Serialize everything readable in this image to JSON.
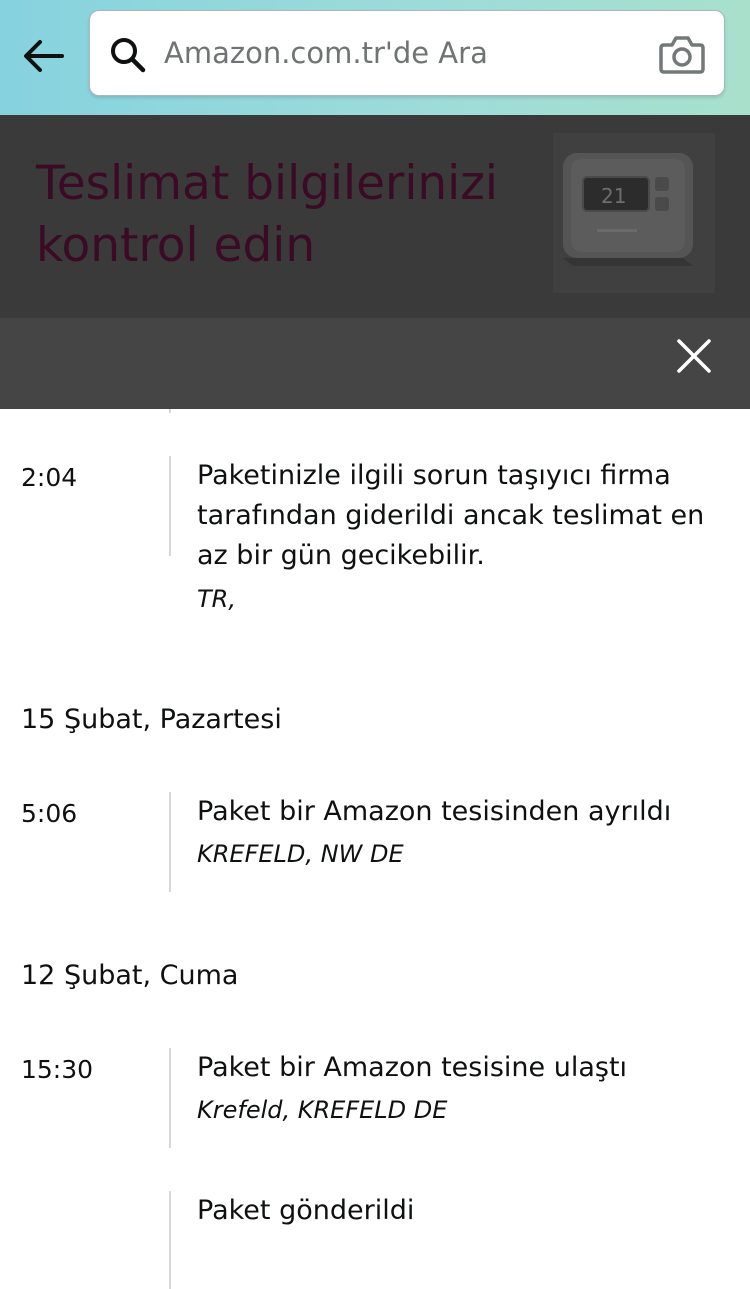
{
  "search": {
    "placeholder": "Amazon.com.tr'de Ara"
  },
  "banner": {
    "title": "Teslimat bilgilerinizi kontrol edin"
  },
  "timeline": {
    "entry1": {
      "time": "2:04",
      "event": "Paketinizle ilgili sorun taşıyıcı firma tarafından giderildi ancak teslimat en az bir gün gecikebilir.",
      "location": "TR,"
    },
    "date2": "15 Şubat, Pazartesi",
    "entry2": {
      "time": "5:06",
      "event": "Paket bir Amazon tesisinden ayrıldı",
      "location": "KREFELD, NW DE"
    },
    "date3": "12 Şubat, Cuma",
    "entry3": {
      "time": "15:30",
      "event": "Paket bir Amazon tesisine ulaştı",
      "location": "Krefeld, KREFELD DE"
    },
    "entry4": {
      "event": "Paket gönderildi"
    }
  },
  "icons": {
    "back": "arrow-left-icon",
    "search": "search-icon",
    "camera": "camera-icon",
    "close": "close-icon"
  },
  "colors": {
    "header_gradient_start": "#86d2df",
    "header_gradient_end": "#a8e0cc",
    "overlay_dark": "#3a3a3a",
    "banner_title": "#3b0a25",
    "timeline_line": "#d5d9d9"
  }
}
